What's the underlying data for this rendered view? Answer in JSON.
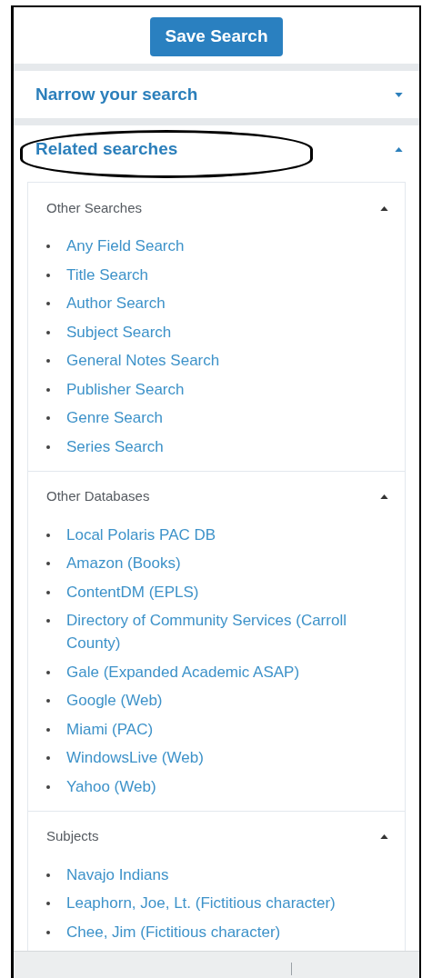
{
  "save_button": "Save Search",
  "panels": [
    {
      "title": "Narrow your search",
      "expanded": false,
      "highlighted": false
    },
    {
      "title": "Related searches",
      "expanded": true,
      "highlighted": true,
      "groups": [
        {
          "title": "Other Searches",
          "expanded": true,
          "links": [
            "Any Field Search",
            "Title Search",
            "Author Search",
            "Subject Search",
            "General Notes Search",
            "Publisher Search",
            "Genre Search",
            "Series Search"
          ]
        },
        {
          "title": "Other Databases",
          "expanded": true,
          "links": [
            "Local Polaris PAC DB",
            "Amazon (Books)",
            "ContentDM (EPLS)",
            "Directory of Community Services (Carroll County)",
            "Gale (Expanded Academic ASAP)",
            "Google (Web)",
            "Miami (PAC)",
            "WindowsLive (Web)",
            "Yahoo (Web)"
          ]
        },
        {
          "title": "Subjects",
          "expanded": true,
          "links": [
            "Navajo Indians",
            "Leaphorn, Joe, Lt. (Fictitious character)",
            "Chee, Jim (Fictitious character)"
          ]
        }
      ]
    }
  ]
}
